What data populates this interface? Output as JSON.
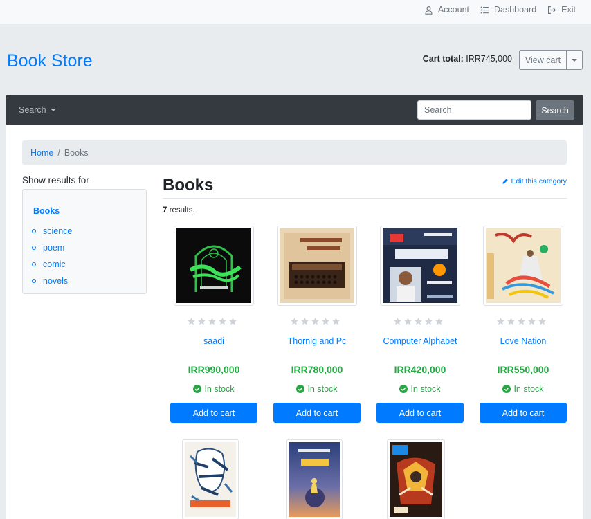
{
  "topnav": {
    "account": "Account",
    "dashboard": "Dashboard",
    "exit": "Exit"
  },
  "brand": "Book Store",
  "cart": {
    "label": "Cart total:",
    "total": "IRR745,000",
    "view": "View cart"
  },
  "navbar": {
    "search_menu": "Search",
    "search_placeholder": "Search",
    "search_button": "Search"
  },
  "breadcrumb": {
    "home": "Home",
    "sep": "/",
    "current": "Books"
  },
  "sidebar": {
    "title": "Show results for",
    "root": "Books",
    "items": [
      {
        "label": "science"
      },
      {
        "label": "poem"
      },
      {
        "label": "comic"
      },
      {
        "label": "novels"
      }
    ]
  },
  "page": {
    "title": "Books",
    "edit": "Edit this category",
    "results_count": "7",
    "results_label": "results."
  },
  "products": [
    {
      "name": "saadi",
      "price": "IRR990,000",
      "stock": "In stock",
      "add": "Add to cart",
      "rating": 0
    },
    {
      "name": "Thornig and Pc",
      "price": "IRR780,000",
      "stock": "In stock",
      "add": "Add to cart",
      "rating": 0
    },
    {
      "name": "Computer Alphabet",
      "price": "IRR420,000",
      "stock": "In stock",
      "add": "Add to cart",
      "rating": 0
    },
    {
      "name": "Love Nation",
      "price": "IRR550,000",
      "stock": "In stock",
      "add": "Add to cart",
      "rating": 0
    }
  ],
  "colors": {
    "primary": "#007bff",
    "success": "#28a745",
    "navbar": "#343a40",
    "secondary": "#6c757d",
    "star": "#ced4da"
  },
  "icons": {
    "account": "user-icon",
    "dashboard": "list-icon",
    "exit": "sign-out-icon",
    "edit": "pencil-icon",
    "stock": "check-circle-icon",
    "rating": "star-icon"
  }
}
